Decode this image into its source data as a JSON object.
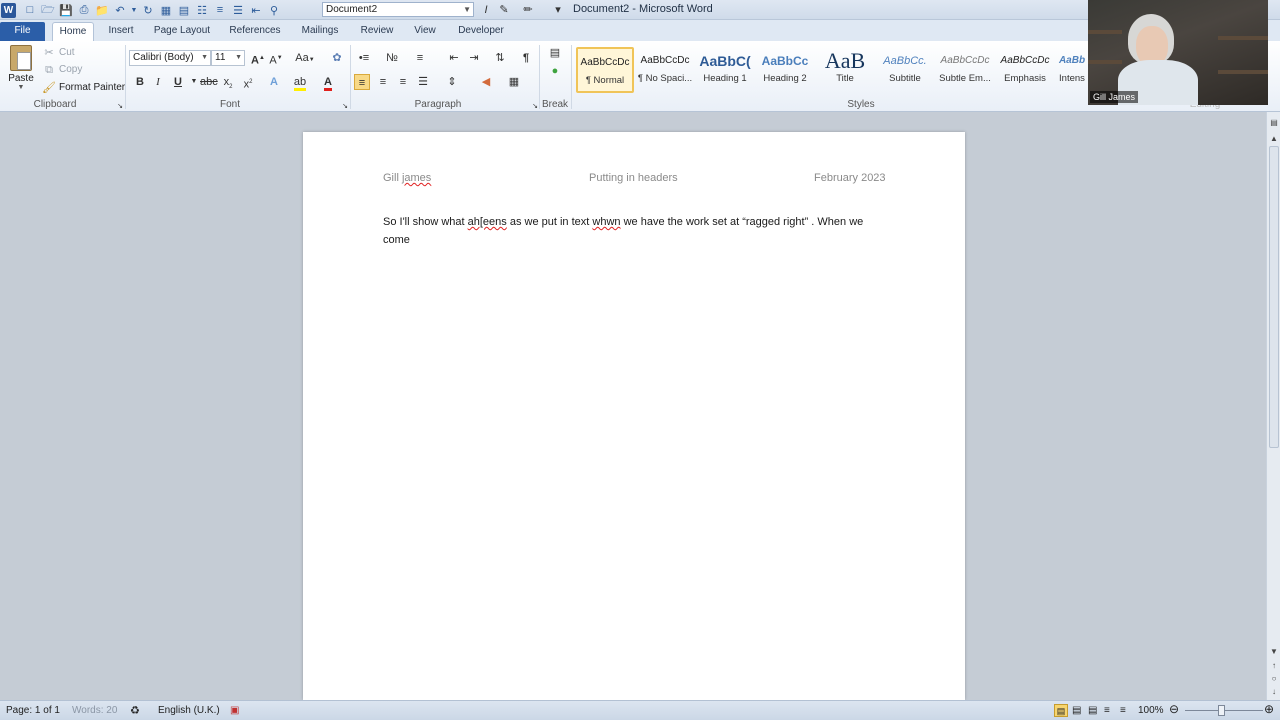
{
  "window": {
    "title": "Document2 - Microsoft Word",
    "doc_box": "Document2"
  },
  "tabs": [
    "File",
    "Home",
    "Insert",
    "Page Layout",
    "References",
    "Mailings",
    "Review",
    "View",
    "Developer"
  ],
  "clipboard": {
    "paste": "Paste",
    "cut": "Cut",
    "copy": "Copy",
    "format_painter": "Format Painter",
    "label": "Clipboard"
  },
  "font": {
    "name": "Calibri (Body)",
    "size": "11",
    "label": "Font"
  },
  "paragraph": {
    "label": "Paragraph"
  },
  "break": {
    "label": "Break"
  },
  "styles": {
    "label": "Styles",
    "items": [
      {
        "sample": "AaBbCcDc",
        "name": "¶ Normal"
      },
      {
        "sample": "AaBbCcDc",
        "name": "¶ No Spaci..."
      },
      {
        "sample": "AaBbC(",
        "name": "Heading 1"
      },
      {
        "sample": "AaBbCc",
        "name": "Heading 2"
      },
      {
        "sample": "AaB",
        "name": "Title"
      },
      {
        "sample": "AaBbCc.",
        "name": "Subtitle"
      },
      {
        "sample": "AaBbCcDc",
        "name": "Subtle Em..."
      },
      {
        "sample": "AaBbCcDc",
        "name": "Emphasis"
      },
      {
        "sample": "AaBb",
        "name": "Intens"
      }
    ]
  },
  "editing": {
    "label": "Editing"
  },
  "webcam": {
    "name": "Gill James"
  },
  "document": {
    "header_left_1": "Gill ",
    "header_left_2": "james",
    "header_center": "Putting in headers",
    "header_right": "February 2023",
    "body": {
      "p1": "So I'll show what ",
      "p2": "ah[eens",
      "p3": " as we put in  text ",
      "p4": "whwn",
      "p5": " we have the work set at “ragged right” . When we",
      "p6": "come"
    }
  },
  "status": {
    "page": "Page: 1 of 1",
    "words": "Words: 20",
    "language": "English (U.K.)",
    "zoom": "100%"
  },
  "colors": {
    "file_tab": "#2b5ea8",
    "accent": "#2b579a",
    "spell_error": "#e02020"
  }
}
